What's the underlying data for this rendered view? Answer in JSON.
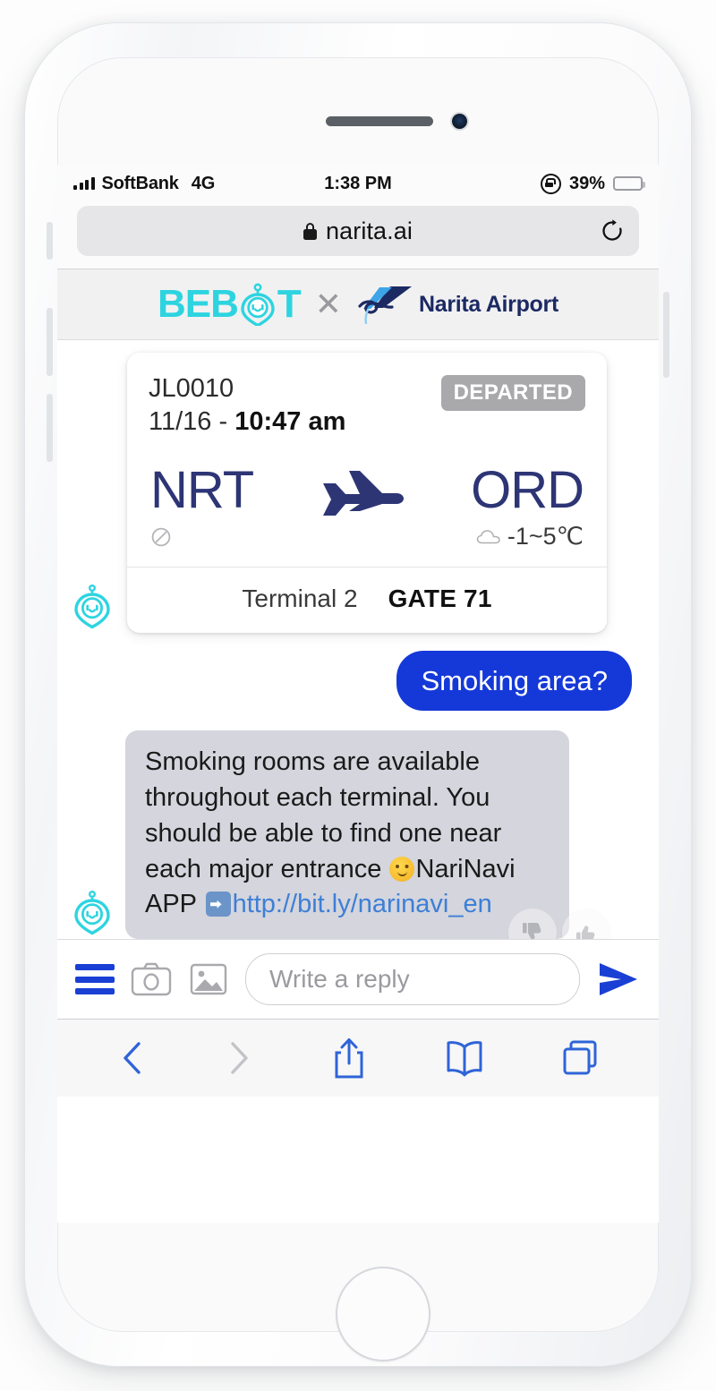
{
  "status_bar": {
    "signal_icon": "signal-bars-icon",
    "carrier": "SoftBank",
    "network": "4G",
    "time": "1:38 PM",
    "rotation_lock_icon": "rotation-lock-icon",
    "battery_percent": "39%",
    "battery_level": 39,
    "battery_color": "#fdbc1c"
  },
  "browser": {
    "lock_icon": "lock-icon",
    "url": "narita.ai",
    "reload_icon": "reload-icon",
    "toolbar": {
      "back_icon": "chevron-left-icon",
      "forward_icon": "chevron-right-icon",
      "share_icon": "share-icon",
      "bookmarks_icon": "book-icon",
      "tabs_icon": "tabs-icon",
      "back_enabled": true,
      "forward_enabled": false,
      "accent_color": "#2f64d8",
      "disabled_color": "#c3c3c7"
    }
  },
  "header": {
    "brand_text_1": "BEB",
    "brand_robot_icon": "bebot-robot-icon",
    "brand_text_2": "T",
    "brand_color": "#2dd4e0",
    "separator": "✕",
    "partner_mark_icon": "narita-airport-mark-icon",
    "partner_name": "Narita Airport",
    "partner_color": "#1c2a63"
  },
  "flight_card": {
    "flight_number": "JL0010",
    "date": "11/16",
    "separator": "-",
    "time": "10:47 am",
    "status": "DEPARTED",
    "status_color": "#a9a9ac",
    "origin_code": "NRT",
    "destination_code": "ORD",
    "plane_icon": "airplane-icon",
    "code_color": "#2d3575",
    "origin_weather_icon": "no-data-icon",
    "origin_weather": "",
    "destination_weather_icon": "cloud-icon",
    "destination_weather": "-1~5℃",
    "terminal": "Terminal 2",
    "gate": "GATE 71"
  },
  "messages": {
    "bot_avatar_icon": "bebot-avatar-icon",
    "user_message": "Smoking area?",
    "user_bubble_color": "#1539d8",
    "bot_message_part1": "Smoking rooms are available throughout each terminal. You should be able to find one near each major entrance ",
    "bot_emoji_smiley": "slightly-smiling-face-emoji",
    "bot_message_part2": "NariNavi APP ",
    "bot_emoji_arrow": "right-arrow-emoji",
    "bot_link_text": "http://bit.ly/narinavi_en",
    "bot_bubble_color": "#d4d5dd",
    "link_color": "#3d7fd6",
    "feedback_down_icon": "thumbs-down-icon",
    "feedback_up_icon": "thumbs-up-icon"
  },
  "composer": {
    "menu_icon": "hamburger-menu-icon",
    "camera_icon": "camera-icon",
    "photo_icon": "photo-library-icon",
    "placeholder": "Write a reply",
    "input_value": "",
    "send_icon": "send-arrow-icon",
    "accent_color": "#1a3fd4"
  }
}
